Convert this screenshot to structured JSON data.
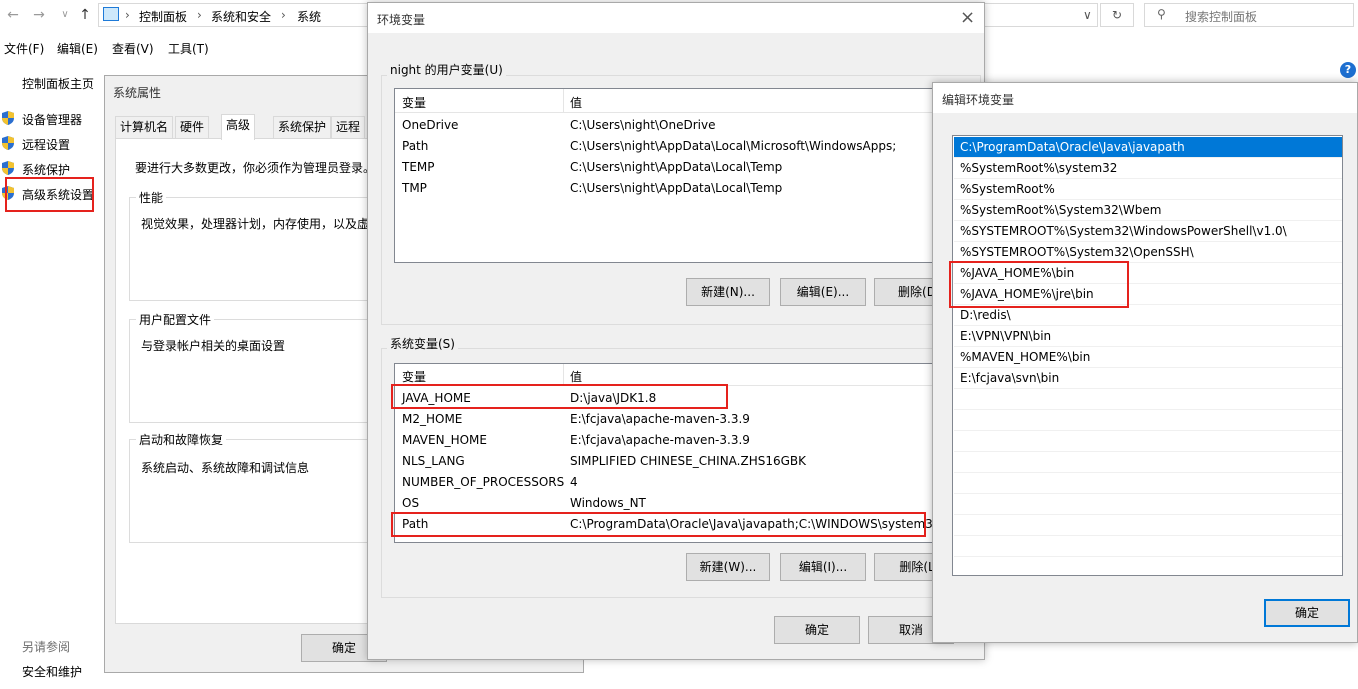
{
  "explorer": {
    "breadcrumb": [
      "控制面板",
      "系统和安全",
      "系统"
    ],
    "search_placeholder": "搜索控制面板",
    "menu": [
      "文件(F)",
      "编辑(E)",
      "查看(V)",
      "工具(T)"
    ],
    "left_nav": {
      "home": "控制面板主页",
      "items": [
        "设备管理器",
        "远程设置",
        "系统保护",
        "高级系统设置"
      ],
      "see_also": "另请参阅",
      "see_also_items": [
        "安全和维护"
      ]
    }
  },
  "sysprops": {
    "title": "系统属性",
    "tabs": [
      "计算机名",
      "硬件",
      "高级",
      "系统保护",
      "远程"
    ],
    "admin_note": "要进行大多数更改，你必须作为管理员登录。",
    "perf_label": "性能",
    "perf_desc": "视觉效果，处理器计划，内存使用，以及虚",
    "profile_label": "用户配置文件",
    "profile_desc": "与登录帐户相关的桌面设置",
    "startup_label": "启动和故障恢复",
    "startup_desc": "系统启动、系统故障和调试信息",
    "ok": "确定"
  },
  "envvars": {
    "title": "环境变量",
    "user_group": "night 的用户变量(U)",
    "col_var": "变量",
    "col_val": "值",
    "user_vars": [
      {
        "name": "OneDrive",
        "value": "C:\\Users\\night\\OneDrive"
      },
      {
        "name": "Path",
        "value": "C:\\Users\\night\\AppData\\Local\\Microsoft\\WindowsApps;"
      },
      {
        "name": "TEMP",
        "value": "C:\\Users\\night\\AppData\\Local\\Temp"
      },
      {
        "name": "TMP",
        "value": "C:\\Users\\night\\AppData\\Local\\Temp"
      }
    ],
    "user_new": "新建(N)...",
    "user_edit": "编辑(E)...",
    "user_delete": "删除(D",
    "sys_group": "系统变量(S)",
    "sys_vars": [
      {
        "name": "JAVA_HOME",
        "value": "D:\\java\\JDK1.8"
      },
      {
        "name": "M2_HOME",
        "value": "E:\\fcjava\\apache-maven-3.3.9"
      },
      {
        "name": "MAVEN_HOME",
        "value": "E:\\fcjava\\apache-maven-3.3.9"
      },
      {
        "name": "NLS_LANG",
        "value": "SIMPLIFIED CHINESE_CHINA.ZHS16GBK"
      },
      {
        "name": "NUMBER_OF_PROCESSORS",
        "value": "4"
      },
      {
        "name": "OS",
        "value": "Windows_NT"
      },
      {
        "name": "Path",
        "value": "C:\\ProgramData\\Oracle\\Java\\javapath;C:\\WINDOWS\\system3..."
      }
    ],
    "sys_new": "新建(W)...",
    "sys_edit": "编辑(I)...",
    "sys_delete": "删除(L",
    "ok": "确定",
    "cancel": "取消"
  },
  "editenv": {
    "title": "编辑环境变量",
    "items": [
      "C:\\ProgramData\\Oracle\\Java\\javapath",
      "%SystemRoot%\\system32",
      "%SystemRoot%",
      "%SystemRoot%\\System32\\Wbem",
      "%SYSTEMROOT%\\System32\\WindowsPowerShell\\v1.0\\",
      "%SYSTEMROOT%\\System32\\OpenSSH\\",
      "%JAVA_HOME%\\bin",
      "%JAVA_HOME%\\jre\\bin",
      "D:\\redis\\",
      "E:\\VPN\\VPN\\bin",
      "%MAVEN_HOME%\\bin",
      "E:\\fcjava\\svn\\bin"
    ],
    "ok": "确定"
  },
  "colors": {
    "highlight": "#e5221d",
    "selection": "#0078d7",
    "dialog_bg": "#f0f0f0"
  }
}
